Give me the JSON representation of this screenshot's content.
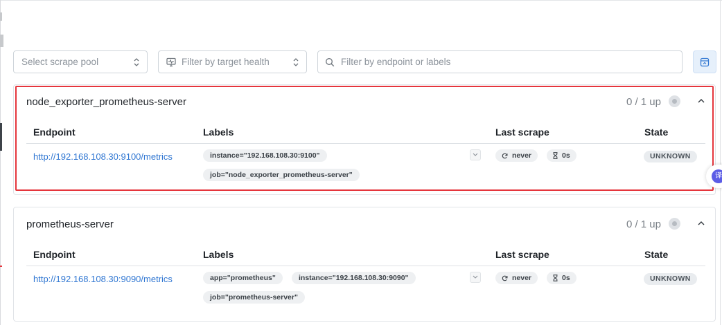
{
  "toolbar": {
    "scrape_pool_placeholder": "Select scrape pool",
    "health_placeholder": "Filter by target health",
    "search_placeholder": "Filter by endpoint or labels"
  },
  "table_headers": {
    "endpoint": "Endpoint",
    "labels": "Labels",
    "last_scrape": "Last scrape",
    "state": "State"
  },
  "pools": [
    {
      "name": "node_exporter_prometheus-server",
      "up_count": "0 / 1 up",
      "target": {
        "endpoint": "http://192.168.108.30:9100/metrics",
        "labels": [
          "instance=\"192.168.108.30:9100\"",
          "job=\"node_exporter_prometheus-server\""
        ],
        "last_scrape": "never",
        "scrape_duration": "0s",
        "state": "UNKNOWN"
      }
    },
    {
      "name": "prometheus-server",
      "up_count": "0 / 1 up",
      "target": {
        "endpoint": "http://192.168.108.30:9090/metrics",
        "labels": [
          "app=\"prometheus\"",
          "instance=\"192.168.108.30:9090\"",
          "job=\"prometheus-server\""
        ],
        "last_scrape": "never",
        "scrape_duration": "0s",
        "state": "UNKNOWN"
      }
    }
  ],
  "floating_badge": "译",
  "colors": {
    "link": "#2f76d2",
    "highlight_border": "#e5353c",
    "pill_bg": "#eef0f2",
    "collapse_button_bg": "#e6f0fb"
  }
}
